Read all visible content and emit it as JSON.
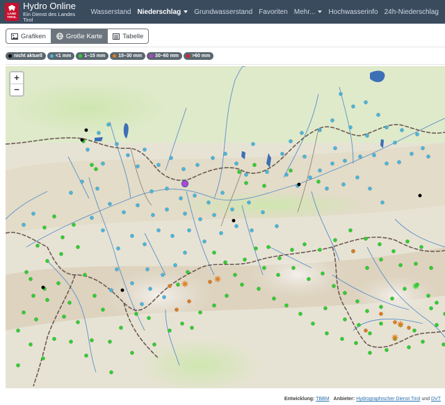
{
  "header": {
    "logo_text": "LAND TIROL",
    "title": "Hydro Online",
    "subtitle": "Ein Dienst des Landes Tirol",
    "nav": [
      {
        "label": "Wasserstand",
        "active": false,
        "dropdown": false
      },
      {
        "label": "Niederschlag",
        "active": true,
        "dropdown": true
      },
      {
        "label": "Grundwasserstand",
        "active": false,
        "dropdown": false
      },
      {
        "label": "Favoriten",
        "active": false,
        "dropdown": false
      },
      {
        "label": "Mehr...",
        "active": false,
        "dropdown": true
      },
      {
        "label": "Hochwasserinfo",
        "active": false,
        "dropdown": false
      },
      {
        "label": "24h-Niederschlag",
        "active": false,
        "dropdown": false
      }
    ]
  },
  "views": [
    {
      "label": "Grafiken",
      "icon": "image-icon",
      "active": false
    },
    {
      "label": "Große Karte",
      "icon": "globe-icon",
      "active": true
    },
    {
      "label": "Tabelle",
      "icon": "table-icon",
      "active": false
    }
  ],
  "legend": [
    {
      "label": "nicht aktuell",
      "color": "#000000"
    },
    {
      "label": "<1 mm",
      "color": "#49b6de"
    },
    {
      "label": "1–15 mm",
      "color": "#2fcf2f"
    },
    {
      "label": "15–30 mm",
      "color": "#e07b1e"
    },
    {
      "label": "30–60 mm",
      "color": "#c23cd9"
    },
    {
      "label": ">60 mm",
      "color": "#e02020"
    }
  ],
  "map": {
    "zoom_in": "+",
    "zoom_out": "−"
  },
  "footer": {
    "dev_label": "Entwicklung:",
    "dev_link": "TBBM",
    "provider_label": "Anbieter:",
    "provider_link1": "Hydrographischer Dienst Tirol",
    "and": "und",
    "provider_link2": "DVT"
  },
  "colors": {
    "navbar": "#3a4b5e",
    "accent_red": "#c8102e",
    "map_base": "#e9e6d9",
    "river": "#5b8fc7",
    "border": "#6b5a52"
  }
}
